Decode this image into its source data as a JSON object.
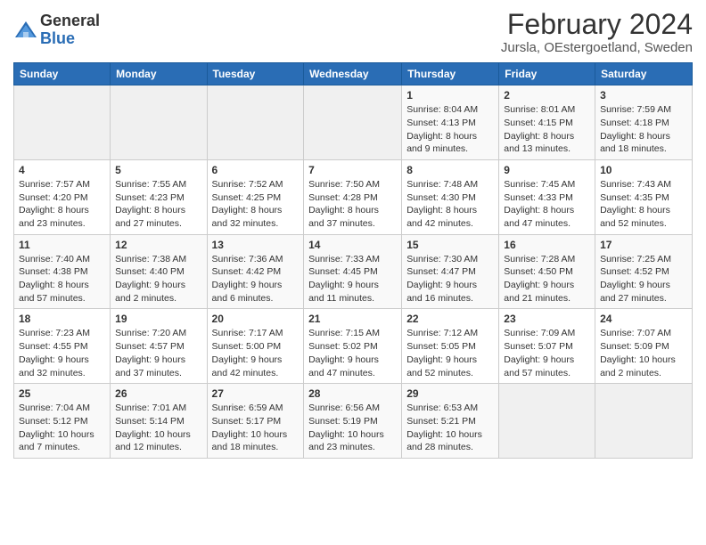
{
  "logo": {
    "general": "General",
    "blue": "Blue"
  },
  "header": {
    "title": "February 2024",
    "subtitle": "Jursla, OEstergoetland, Sweden"
  },
  "weekdays": [
    "Sunday",
    "Monday",
    "Tuesday",
    "Wednesday",
    "Thursday",
    "Friday",
    "Saturday"
  ],
  "weeks": [
    [
      {
        "day": "",
        "info": ""
      },
      {
        "day": "",
        "info": ""
      },
      {
        "day": "",
        "info": ""
      },
      {
        "day": "",
        "info": ""
      },
      {
        "day": "1",
        "info": "Sunrise: 8:04 AM\nSunset: 4:13 PM\nDaylight: 8 hours\nand 9 minutes."
      },
      {
        "day": "2",
        "info": "Sunrise: 8:01 AM\nSunset: 4:15 PM\nDaylight: 8 hours\nand 13 minutes."
      },
      {
        "day": "3",
        "info": "Sunrise: 7:59 AM\nSunset: 4:18 PM\nDaylight: 8 hours\nand 18 minutes."
      }
    ],
    [
      {
        "day": "4",
        "info": "Sunrise: 7:57 AM\nSunset: 4:20 PM\nDaylight: 8 hours\nand 23 minutes."
      },
      {
        "day": "5",
        "info": "Sunrise: 7:55 AM\nSunset: 4:23 PM\nDaylight: 8 hours\nand 27 minutes."
      },
      {
        "day": "6",
        "info": "Sunrise: 7:52 AM\nSunset: 4:25 PM\nDaylight: 8 hours\nand 32 minutes."
      },
      {
        "day": "7",
        "info": "Sunrise: 7:50 AM\nSunset: 4:28 PM\nDaylight: 8 hours\nand 37 minutes."
      },
      {
        "day": "8",
        "info": "Sunrise: 7:48 AM\nSunset: 4:30 PM\nDaylight: 8 hours\nand 42 minutes."
      },
      {
        "day": "9",
        "info": "Sunrise: 7:45 AM\nSunset: 4:33 PM\nDaylight: 8 hours\nand 47 minutes."
      },
      {
        "day": "10",
        "info": "Sunrise: 7:43 AM\nSunset: 4:35 PM\nDaylight: 8 hours\nand 52 minutes."
      }
    ],
    [
      {
        "day": "11",
        "info": "Sunrise: 7:40 AM\nSunset: 4:38 PM\nDaylight: 8 hours\nand 57 minutes."
      },
      {
        "day": "12",
        "info": "Sunrise: 7:38 AM\nSunset: 4:40 PM\nDaylight: 9 hours\nand 2 minutes."
      },
      {
        "day": "13",
        "info": "Sunrise: 7:36 AM\nSunset: 4:42 PM\nDaylight: 9 hours\nand 6 minutes."
      },
      {
        "day": "14",
        "info": "Sunrise: 7:33 AM\nSunset: 4:45 PM\nDaylight: 9 hours\nand 11 minutes."
      },
      {
        "day": "15",
        "info": "Sunrise: 7:30 AM\nSunset: 4:47 PM\nDaylight: 9 hours\nand 16 minutes."
      },
      {
        "day": "16",
        "info": "Sunrise: 7:28 AM\nSunset: 4:50 PM\nDaylight: 9 hours\nand 21 minutes."
      },
      {
        "day": "17",
        "info": "Sunrise: 7:25 AM\nSunset: 4:52 PM\nDaylight: 9 hours\nand 27 minutes."
      }
    ],
    [
      {
        "day": "18",
        "info": "Sunrise: 7:23 AM\nSunset: 4:55 PM\nDaylight: 9 hours\nand 32 minutes."
      },
      {
        "day": "19",
        "info": "Sunrise: 7:20 AM\nSunset: 4:57 PM\nDaylight: 9 hours\nand 37 minutes."
      },
      {
        "day": "20",
        "info": "Sunrise: 7:17 AM\nSunset: 5:00 PM\nDaylight: 9 hours\nand 42 minutes."
      },
      {
        "day": "21",
        "info": "Sunrise: 7:15 AM\nSunset: 5:02 PM\nDaylight: 9 hours\nand 47 minutes."
      },
      {
        "day": "22",
        "info": "Sunrise: 7:12 AM\nSunset: 5:05 PM\nDaylight: 9 hours\nand 52 minutes."
      },
      {
        "day": "23",
        "info": "Sunrise: 7:09 AM\nSunset: 5:07 PM\nDaylight: 9 hours\nand 57 minutes."
      },
      {
        "day": "24",
        "info": "Sunrise: 7:07 AM\nSunset: 5:09 PM\nDaylight: 10 hours\nand 2 minutes."
      }
    ],
    [
      {
        "day": "25",
        "info": "Sunrise: 7:04 AM\nSunset: 5:12 PM\nDaylight: 10 hours\nand 7 minutes."
      },
      {
        "day": "26",
        "info": "Sunrise: 7:01 AM\nSunset: 5:14 PM\nDaylight: 10 hours\nand 12 minutes."
      },
      {
        "day": "27",
        "info": "Sunrise: 6:59 AM\nSunset: 5:17 PM\nDaylight: 10 hours\nand 18 minutes."
      },
      {
        "day": "28",
        "info": "Sunrise: 6:56 AM\nSunset: 5:19 PM\nDaylight: 10 hours\nand 23 minutes."
      },
      {
        "day": "29",
        "info": "Sunrise: 6:53 AM\nSunset: 5:21 PM\nDaylight: 10 hours\nand 28 minutes."
      },
      {
        "day": "",
        "info": ""
      },
      {
        "day": "",
        "info": ""
      }
    ]
  ]
}
